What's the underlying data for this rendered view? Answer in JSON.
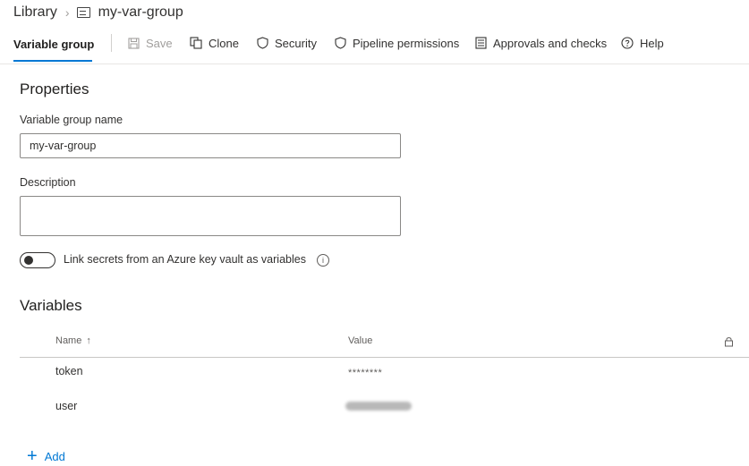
{
  "breadcrumb": {
    "root": "Library",
    "current": "my-var-group"
  },
  "tabs": {
    "active": "Variable group"
  },
  "commands": [
    {
      "label": "Save",
      "icon": "save-icon",
      "disabled": true
    },
    {
      "label": "Clone",
      "icon": "clone-icon"
    },
    {
      "label": "Security",
      "icon": "shield-icon"
    },
    {
      "label": "Pipeline permissions",
      "icon": "shield-icon"
    },
    {
      "label": "Approvals and checks",
      "icon": "checklist-icon"
    },
    {
      "label": "Help",
      "icon": "help-icon"
    }
  ],
  "properties": {
    "heading": "Properties",
    "name_label": "Variable group name",
    "name_value": "my-var-group",
    "description_label": "Description",
    "description_value": "",
    "keyvault_toggle_label": "Link secrets from an Azure key vault as variables",
    "keyvault_enabled": false,
    "info_glyph": "i"
  },
  "variables": {
    "heading": "Variables",
    "columns": {
      "name": "Name",
      "name_sort": "↑",
      "value": "Value"
    },
    "rows": [
      {
        "name": "token",
        "value": "********",
        "is_secret": true
      },
      {
        "name": "user",
        "value": "",
        "value_obscured": true
      }
    ],
    "add_glyph": "+",
    "add_label": "Add"
  },
  "colors": {
    "accent": "#0078d4",
    "text": "#323130",
    "muted": "#a19f9d"
  }
}
